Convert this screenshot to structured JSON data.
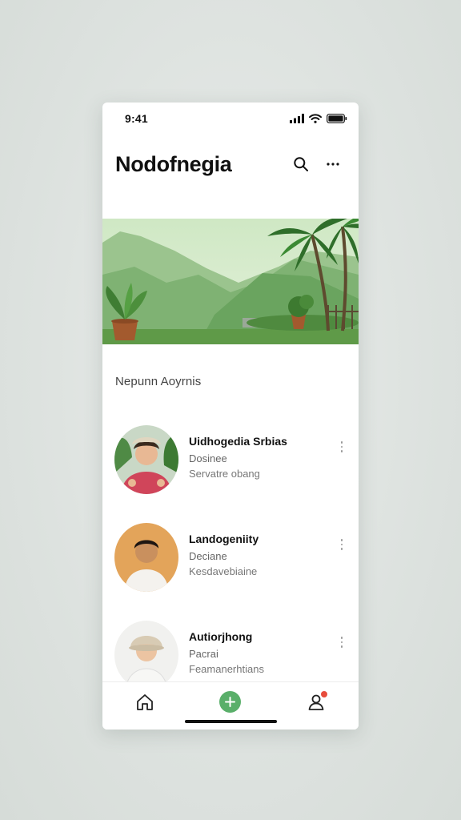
{
  "status_bar": {
    "time": "9:41"
  },
  "header": {
    "title": "Nodofnegia",
    "search_icon": "search-icon",
    "more_icon": "more-horizontal-icon"
  },
  "section": {
    "title": "Nepunn Aoyrnis"
  },
  "contacts": [
    {
      "name": "Uidhogedia Srbias",
      "subtitle": "Dosinee",
      "meta": "Servatre obang"
    },
    {
      "name": "Landogeniity",
      "subtitle": "Deciane",
      "meta": "Kesdavebiaine"
    },
    {
      "name": "Autiorjhong",
      "subtitle": "Pacrai",
      "meta": "Feamanerhtians"
    }
  ],
  "tab_bar": {
    "tabs": [
      "home-icon",
      "add-icon",
      "profile-icon"
    ],
    "accent": "#5aaf6a",
    "badge_color": "#e74c3c"
  }
}
